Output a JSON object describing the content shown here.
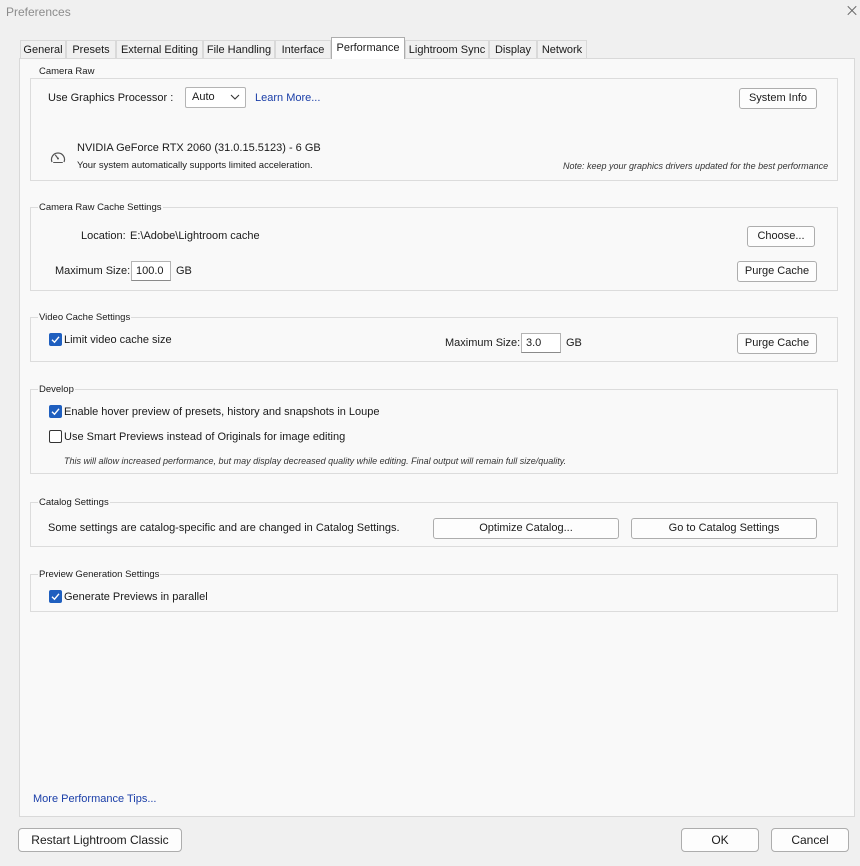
{
  "window": {
    "title": "Preferences"
  },
  "tabs": [
    {
      "label": "General"
    },
    {
      "label": "Presets"
    },
    {
      "label": "External Editing"
    },
    {
      "label": "File Handling"
    },
    {
      "label": "Interface"
    },
    {
      "label": "Performance",
      "active": true
    },
    {
      "label": "Lightroom Sync"
    },
    {
      "label": "Display"
    },
    {
      "label": "Network"
    }
  ],
  "camera_raw": {
    "title": "Camera Raw",
    "gpu_label": "Use Graphics Processor :",
    "gpu_value": "Auto",
    "learn_more": "Learn More...",
    "system_info": "System Info",
    "gpu_name": "NVIDIA GeForce RTX 2060 (31.0.15.5123) - 6 GB",
    "gpu_status": "Your system automatically supports limited acceleration.",
    "note": "Note: keep your graphics drivers updated for the best performance"
  },
  "raw_cache": {
    "title": "Camera Raw Cache Settings",
    "location_label": "Location:",
    "location_value": "E:\\Adobe\\Lightroom cache",
    "choose": "Choose...",
    "max_label": "Maximum Size:",
    "max_value": "100.0",
    "unit": "GB",
    "purge": "Purge Cache"
  },
  "video_cache": {
    "title": "Video Cache Settings",
    "limit_label": "Limit video cache size",
    "limit_checked": true,
    "max_label": "Maximum Size:",
    "max_value": "3.0",
    "unit": "GB",
    "purge": "Purge Cache"
  },
  "develop": {
    "title": "Develop",
    "hover_label": "Enable hover preview of presets, history and snapshots in Loupe",
    "hover_checked": true,
    "smart_label": "Use Smart Previews instead of Originals for image editing",
    "smart_checked": false,
    "smart_note": "This will allow increased performance, but may display decreased quality while editing. Final output will remain full size/quality."
  },
  "catalog": {
    "title": "Catalog Settings",
    "text": "Some settings are catalog-specific and are changed in Catalog Settings.",
    "optimize": "Optimize Catalog...",
    "goto": "Go to Catalog Settings"
  },
  "preview": {
    "title": "Preview Generation Settings",
    "parallel_label": "Generate Previews in parallel",
    "parallel_checked": true
  },
  "footer": {
    "tips": "More Performance Tips...",
    "restart": "Restart Lightroom Classic",
    "ok": "OK",
    "cancel": "Cancel"
  },
  "colors": {
    "accent": "#1f5fbf",
    "link": "#1a3ea8"
  },
  "icons": {
    "gauge": "gauge-icon",
    "close": "close-icon",
    "dropdown": "chevron-down-icon",
    "check": "checkmark-icon"
  }
}
